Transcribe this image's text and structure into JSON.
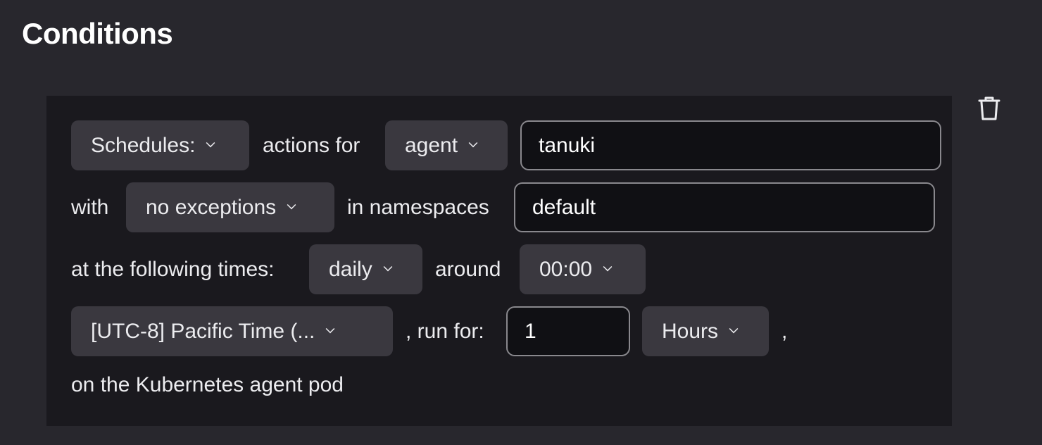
{
  "section": {
    "title": "Conditions"
  },
  "rule": {
    "row1": {
      "source_select": "Schedules:",
      "text_actions_for": "actions for",
      "target_select": "agent",
      "target_value": "tanuki"
    },
    "row2": {
      "text_with": "with",
      "exceptions_select": "no exceptions",
      "text_in_namespaces": "in namespaces",
      "namespaces_value": "default"
    },
    "row3": {
      "text_at_times": "at the following times:",
      "cadence_select": "daily",
      "text_around": "around",
      "time_select": "00:00"
    },
    "row4": {
      "timezone_select": "[UTC-8] Pacific Time (...",
      "text_run_for": ", run for:",
      "duration_value": "1",
      "unit_select": "Hours",
      "text_trailing_comma": ","
    },
    "row5": {
      "text_footer": "on the Kubernetes agent pod"
    }
  },
  "icons": {
    "delete": "trash-icon",
    "dropdown": "chevron-down-icon"
  },
  "colors": {
    "page_bg": "#28272d",
    "card_bg": "#1a191e",
    "dropdown_bg": "#3a383f",
    "input_bg": "#101014",
    "input_border": "#89888d",
    "text": "#ececef"
  }
}
